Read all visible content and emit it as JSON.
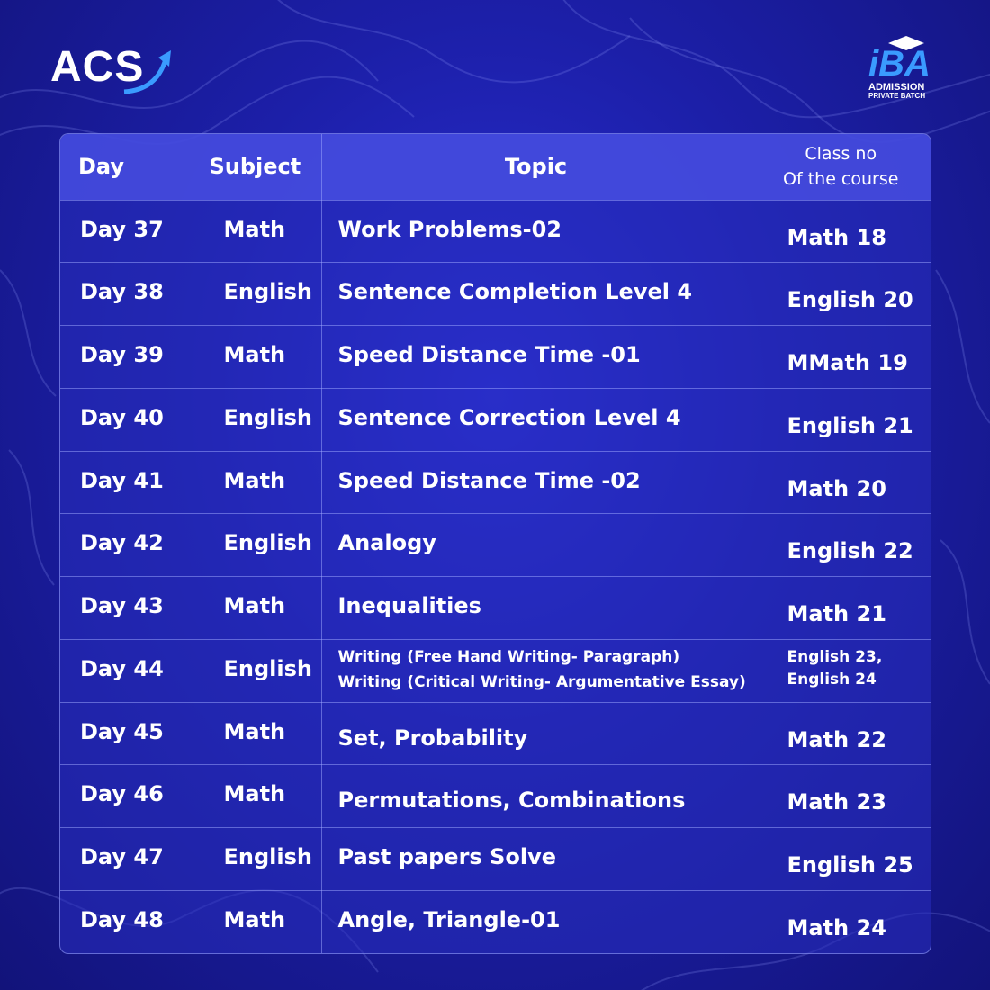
{
  "brand": {
    "left_logo_text": "ACS",
    "right_logo_text": "iBA",
    "right_logo_line1": "ADMISSION",
    "right_logo_line2": "PRIVATE BATCH"
  },
  "colors": {
    "background": "#1c1fa8",
    "header_row": "#464ee1",
    "accent_arrow": "#3a9bff"
  },
  "table": {
    "headers": {
      "day": "Day",
      "subject": "Subject",
      "topic": "Topic",
      "class_line1": "Class no",
      "class_line2": "Of the course"
    },
    "rows": [
      {
        "day": "Day 37",
        "subject": "Math",
        "topic": "Work Problems-02",
        "class": "Math  18"
      },
      {
        "day": "Day 38",
        "subject": "English",
        "topic": "Sentence Completion Level 4",
        "class": "English 20"
      },
      {
        "day": "Day 39",
        "subject": "Math",
        "topic": "Speed Distance Time -01",
        "class": "MMath  19"
      },
      {
        "day": "Day 40",
        "subject": "English",
        "topic": "Sentence Correction Level 4",
        "class": "English 21"
      },
      {
        "day": "Day 41",
        "subject": "Math",
        "topic": "Speed Distance Time -02",
        "class": "Math  20"
      },
      {
        "day": "Day 42",
        "subject": "English",
        "topic": "Analogy",
        "class": "English 22"
      },
      {
        "day": "Day 43",
        "subject": "Math",
        "topic": "Inequalities",
        "class": "Math  21"
      },
      {
        "day": "Day 44",
        "subject": "English",
        "topic_line1": "Writing (Free Hand Writing- Paragraph)",
        "topic_line2": "Writing (Critical Writing- Argumentative Essay)",
        "class_line1": "English 23,",
        "class_line2": "English 24"
      },
      {
        "day": "Day 45",
        "subject": "Math",
        "topic": "Set, Probability",
        "class": "Math  22"
      },
      {
        "day": "Day 46",
        "subject": "Math",
        "topic": "Permutations, Combinations",
        "class": "Math  23"
      },
      {
        "day": "Day 47",
        "subject": "English",
        "topic": "Past papers Solve",
        "class": "English 25"
      },
      {
        "day": "Day 48",
        "subject": "Math",
        "topic": "Angle, Triangle-01",
        "class": "Math  24"
      }
    ]
  }
}
